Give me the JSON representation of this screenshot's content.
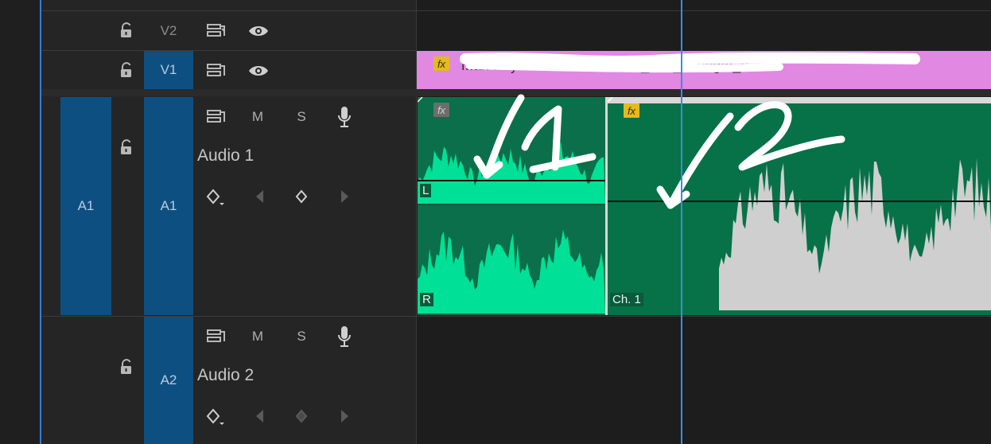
{
  "tracks": {
    "v2": {
      "target": "V2"
    },
    "v1": {
      "target": "V1"
    },
    "a1": {
      "source": "A1",
      "target": "A1",
      "name": "Audio 1",
      "mute": "M",
      "solo": "S"
    },
    "a2": {
      "target": "A2",
      "name": "Audio 2",
      "mute": "M",
      "solo": "S"
    }
  },
  "clips": {
    "v1_clip": {
      "badge": "fx",
      "title": "Man Pay ... 674631718 a ... _and_strength_a"
    },
    "a1_clip1": {
      "badge": "fx",
      "left_channel": "L",
      "right_channel": "R",
      "annotation": "1"
    },
    "a1_clip2": {
      "badge": "fx",
      "channel": "Ch. 1",
      "annotation": "2"
    }
  },
  "colors": {
    "track_target_blue": "#0e4f82",
    "video_clip_pink": "#e188e3",
    "audio_clip_green": "#0a6f4a",
    "waveform_green": "#00e096",
    "waveform_grey": "#cfcfcf",
    "playhead_blue": "#3a8be6",
    "fx_badge_yellow": "#e2bc1d"
  }
}
